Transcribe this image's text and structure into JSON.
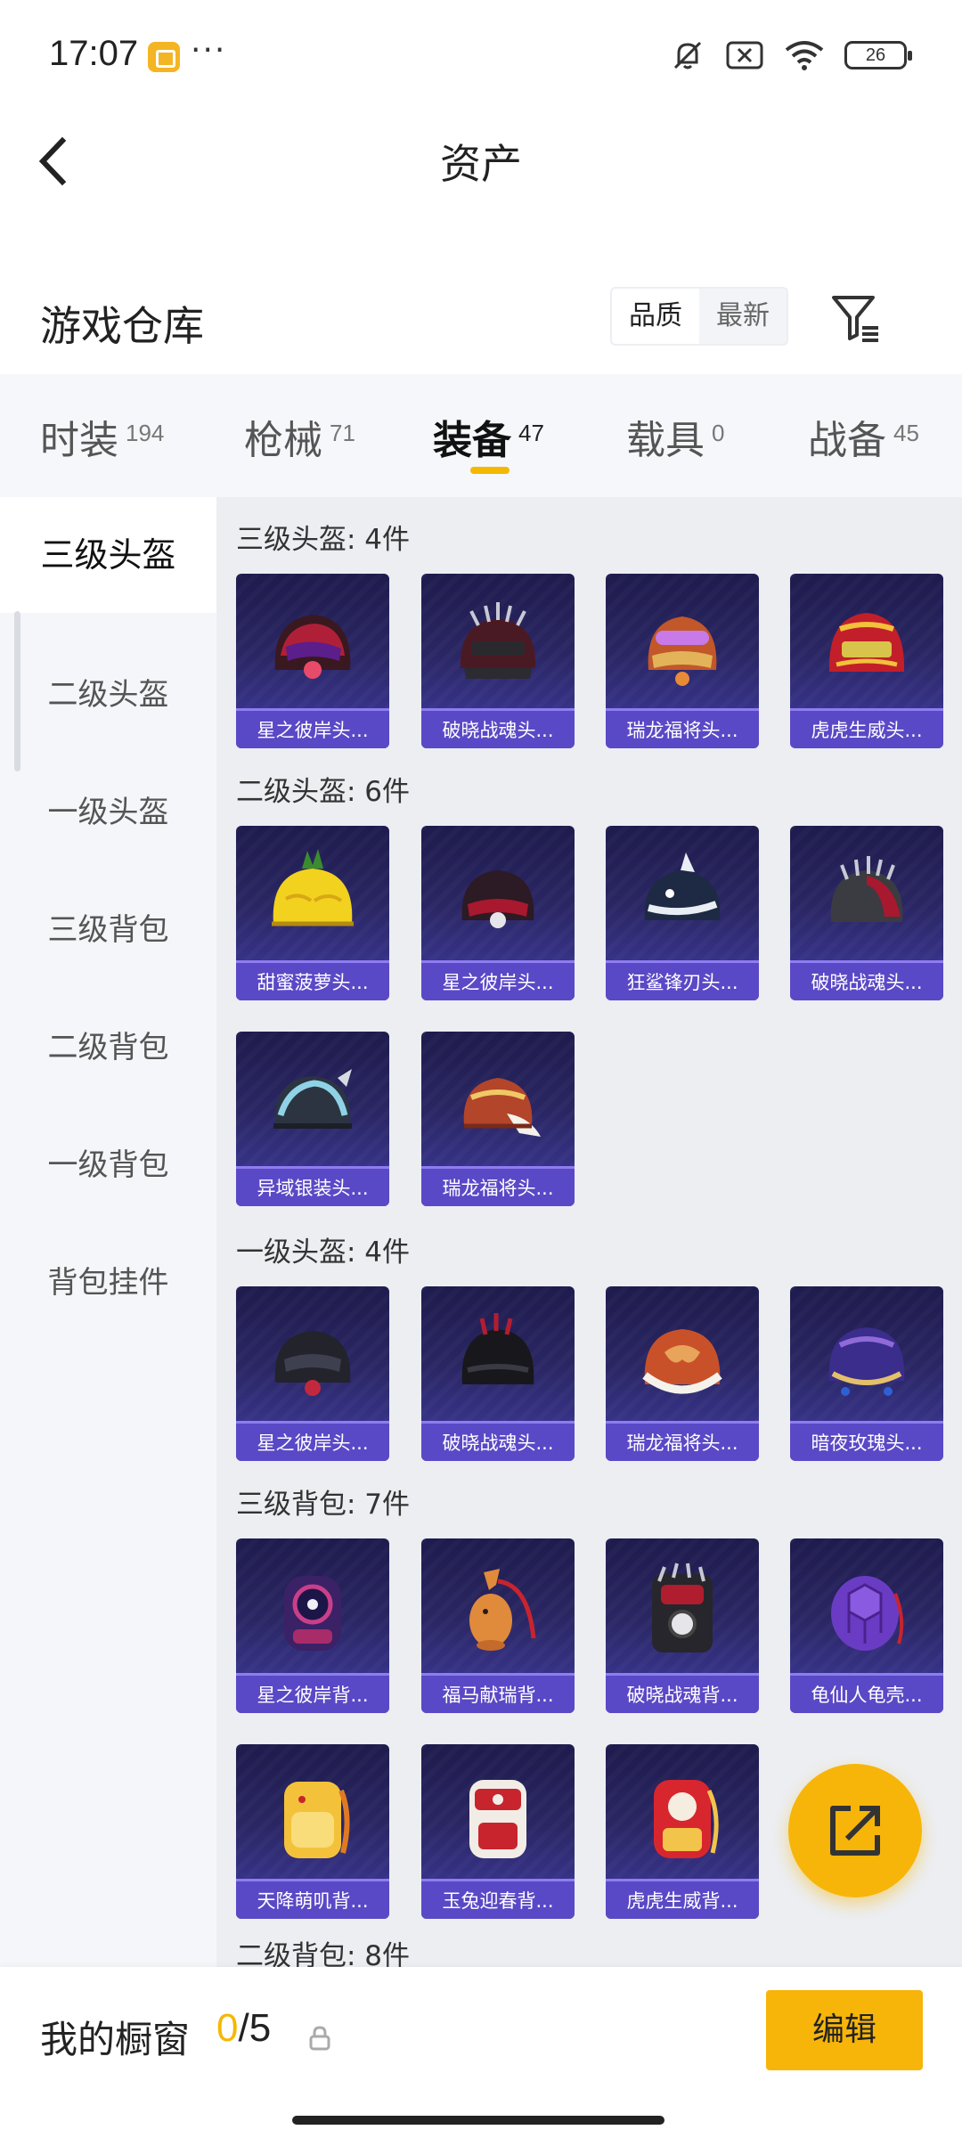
{
  "status_bar": {
    "time": "17:07",
    "app_icon": "note-app-icon",
    "more": "···",
    "icons": [
      "mute-icon",
      "sim-off-icon",
      "wifi-icon"
    ],
    "battery": "26"
  },
  "header": {
    "title": "资产",
    "back_icon": "chevron-left-icon"
  },
  "warehouse": {
    "title": "游戏仓库",
    "sort_options": [
      "品质",
      "最新"
    ],
    "sort_selected": "品质",
    "filter_icon": "filter-icon"
  },
  "tabs": [
    {
      "label": "时装",
      "count": "194"
    },
    {
      "label": "枪械",
      "count": "71"
    },
    {
      "label": "装备",
      "count": "47"
    },
    {
      "label": "载具",
      "count": "0"
    },
    {
      "label": "战备",
      "count": "45"
    }
  ],
  "active_tab": "装备",
  "sidebar": {
    "items": [
      "三级头盔",
      "二级头盔",
      "一级头盔",
      "三级背包",
      "二级背包",
      "一级背包",
      "背包挂件"
    ],
    "active": "三级头盔"
  },
  "sections": [
    {
      "label": "三级头盔: 4件",
      "items": [
        "星之彼岸头...",
        "破晓战魂头...",
        "瑞龙福将头...",
        "虎虎生威头..."
      ]
    },
    {
      "label": "二级头盔: 6件",
      "items": [
        "甜蜜菠萝头...",
        "星之彼岸头...",
        "狂鲨锋刃头...",
        "破晓战魂头...",
        "异域银装头...",
        "瑞龙福将头..."
      ]
    },
    {
      "label": "一级头盔: 4件",
      "items": [
        "星之彼岸头...",
        "破晓战魂头...",
        "瑞龙福将头...",
        "暗夜玫瑰头..."
      ]
    },
    {
      "label": "三级背包: 7件",
      "items": [
        "星之彼岸背...",
        "福马献瑞背...",
        "破晓战魂背...",
        "龟仙人龟壳...",
        "天降萌叽背...",
        "玉兔迎春背...",
        "虎虎生威背..."
      ]
    },
    {
      "label": "二级背包: 8件",
      "items": []
    }
  ],
  "fab_icon": "share-external-icon",
  "bottom": {
    "label": "我的橱窗",
    "current": "0",
    "separator": "/",
    "max": "5",
    "lock_icon": "lock-icon",
    "edit_label": "编辑"
  },
  "colors": {
    "accent": "#f7b509",
    "card_top": "#1e1b4d",
    "card_bottom": "#3f3ba0",
    "card_footer": "#5a49c6"
  }
}
